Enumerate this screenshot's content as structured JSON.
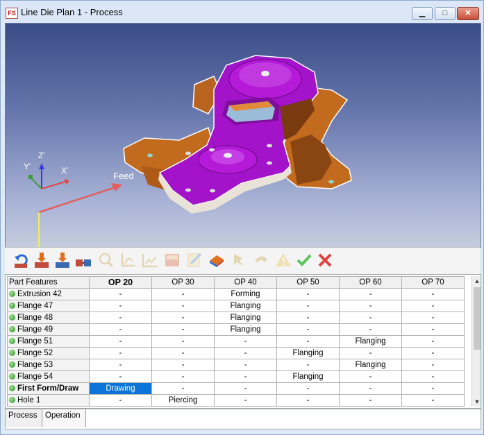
{
  "window": {
    "title": "Line Die Plan 1 - Process",
    "app_icon_text": "FS",
    "controls": {
      "minimize": "▁",
      "maximize": "□",
      "close": "✕"
    }
  },
  "viewport": {
    "axes": {
      "z": "Z'",
      "y": "Y'",
      "x": "X'"
    },
    "feed_label": "Feed"
  },
  "toolbar": {
    "buttons": [
      {
        "icon": "rotate-part-icon",
        "enabled": true
      },
      {
        "icon": "add-operation-before-icon",
        "enabled": true
      },
      {
        "icon": "add-operation-after-icon",
        "enabled": true
      },
      {
        "icon": "merge-operations-icon",
        "enabled": true
      },
      {
        "icon": "feature-lookup-icon",
        "enabled": false
      },
      {
        "icon": "axis-frame-icon",
        "enabled": false
      },
      {
        "icon": "line-chart-icon",
        "enabled": false
      },
      {
        "icon": "grid-image-icon",
        "enabled": false
      },
      {
        "icon": "edit-note-icon",
        "enabled": false
      },
      {
        "icon": "book-icon",
        "enabled": true
      },
      {
        "icon": "pin-feature-icon",
        "enabled": false
      },
      {
        "icon": "hand-pick-icon",
        "enabled": false
      },
      {
        "icon": "warning-icon",
        "enabled": false
      },
      {
        "icon": "accept-check-icon",
        "enabled": true
      },
      {
        "icon": "reject-x-icon",
        "enabled": true
      }
    ]
  },
  "grid": {
    "header_first": "Part Features",
    "columns": [
      "OP 20",
      "OP 30",
      "OP 40",
      "OP 50",
      "OP 60",
      "OP 70"
    ],
    "active_column": 0,
    "rows": [
      {
        "feature": "Extrusion 42",
        "bold": false,
        "cells": [
          "-",
          "-",
          "Forming",
          "-",
          "-",
          "-"
        ]
      },
      {
        "feature": "Flange 47",
        "bold": false,
        "cells": [
          "-",
          "-",
          "Flanging",
          "-",
          "-",
          "-"
        ]
      },
      {
        "feature": "Flange 48",
        "bold": false,
        "cells": [
          "-",
          "-",
          "Flanging",
          "-",
          "-",
          "-"
        ]
      },
      {
        "feature": "Flange 49",
        "bold": false,
        "cells": [
          "-",
          "-",
          "Flanging",
          "-",
          "-",
          "-"
        ]
      },
      {
        "feature": "Flange 51",
        "bold": false,
        "cells": [
          "-",
          "-",
          "-",
          "-",
          "Flanging",
          "-"
        ]
      },
      {
        "feature": "Flange 52",
        "bold": false,
        "cells": [
          "-",
          "-",
          "-",
          "Flanging",
          "-",
          "-"
        ]
      },
      {
        "feature": "Flange 53",
        "bold": false,
        "cells": [
          "-",
          "-",
          "-",
          "-",
          "Flanging",
          "-"
        ]
      },
      {
        "feature": "Flange 54",
        "bold": false,
        "cells": [
          "-",
          "-",
          "-",
          "Flanging",
          "-",
          "-"
        ]
      },
      {
        "feature": "First Form/Draw",
        "bold": true,
        "cells": [
          "Drawing",
          "-",
          "-",
          "-",
          "-",
          "-"
        ],
        "selected_cell": 0
      },
      {
        "feature": "Hole 1",
        "bold": false,
        "cells": [
          "-",
          "Piercing",
          "-",
          "-",
          "-",
          "-"
        ]
      }
    ]
  },
  "tabs": [
    {
      "label": "Process",
      "active": false
    },
    {
      "label": "Operation",
      "active": true
    }
  ],
  "colors": {
    "part_main": "#a213c9",
    "part_flange": "#c26a1e",
    "selected_cell": "#0b74d8",
    "status_dot": "#3a9a34"
  }
}
